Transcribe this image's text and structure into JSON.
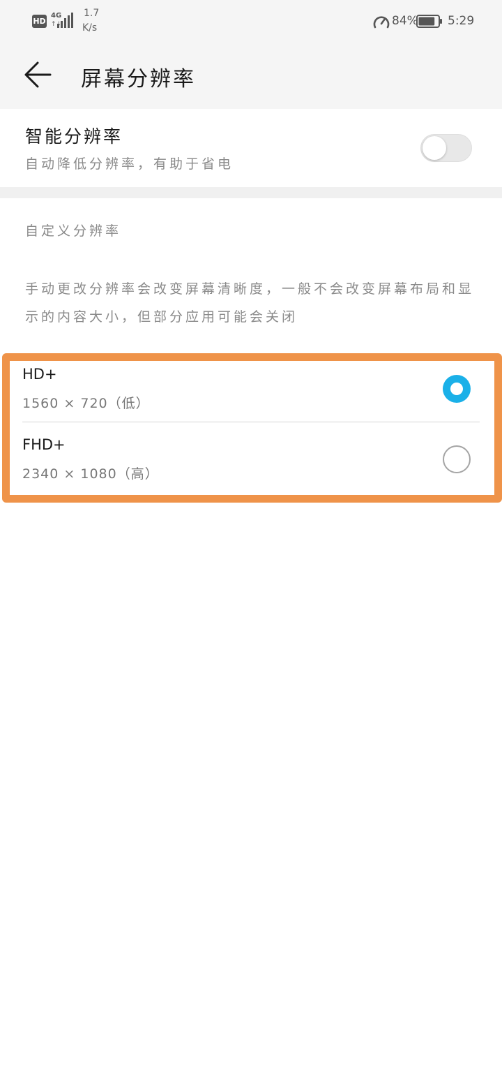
{
  "status_bar": {
    "hd_badge": "HD",
    "network_type": "4G",
    "network_arrows": "↑↓",
    "net_speed_value": "1.7",
    "net_speed_unit": "K/s",
    "battery_percent": "84%",
    "battery_level": 0.84,
    "time": "5:29",
    "icons": [
      "hd-icon",
      "signal-icon",
      "speed-icon",
      "battery-icon"
    ]
  },
  "header": {
    "back_icon": "arrow-left-icon",
    "title": "屏幕分辨率"
  },
  "smart_resolution": {
    "title": "智能分辨率",
    "description": "自动降低分辨率，有助于省电",
    "enabled": false
  },
  "custom_resolution": {
    "label": "自定义分辨率",
    "description": "手动更改分辨率会改变屏幕清晰度，一般不会改变屏幕布局和显示的内容大小，但部分应用可能会关闭",
    "options": [
      {
        "name": "HD+",
        "resolution": "1560 × 720（低）",
        "selected": true
      },
      {
        "name": "FHD+",
        "resolution": "2340 × 1080（高）",
        "selected": false
      }
    ]
  },
  "colors": {
    "accent": "#1ab0e8",
    "highlight_frame": "#ef9349",
    "background": "#f5f5f5"
  }
}
